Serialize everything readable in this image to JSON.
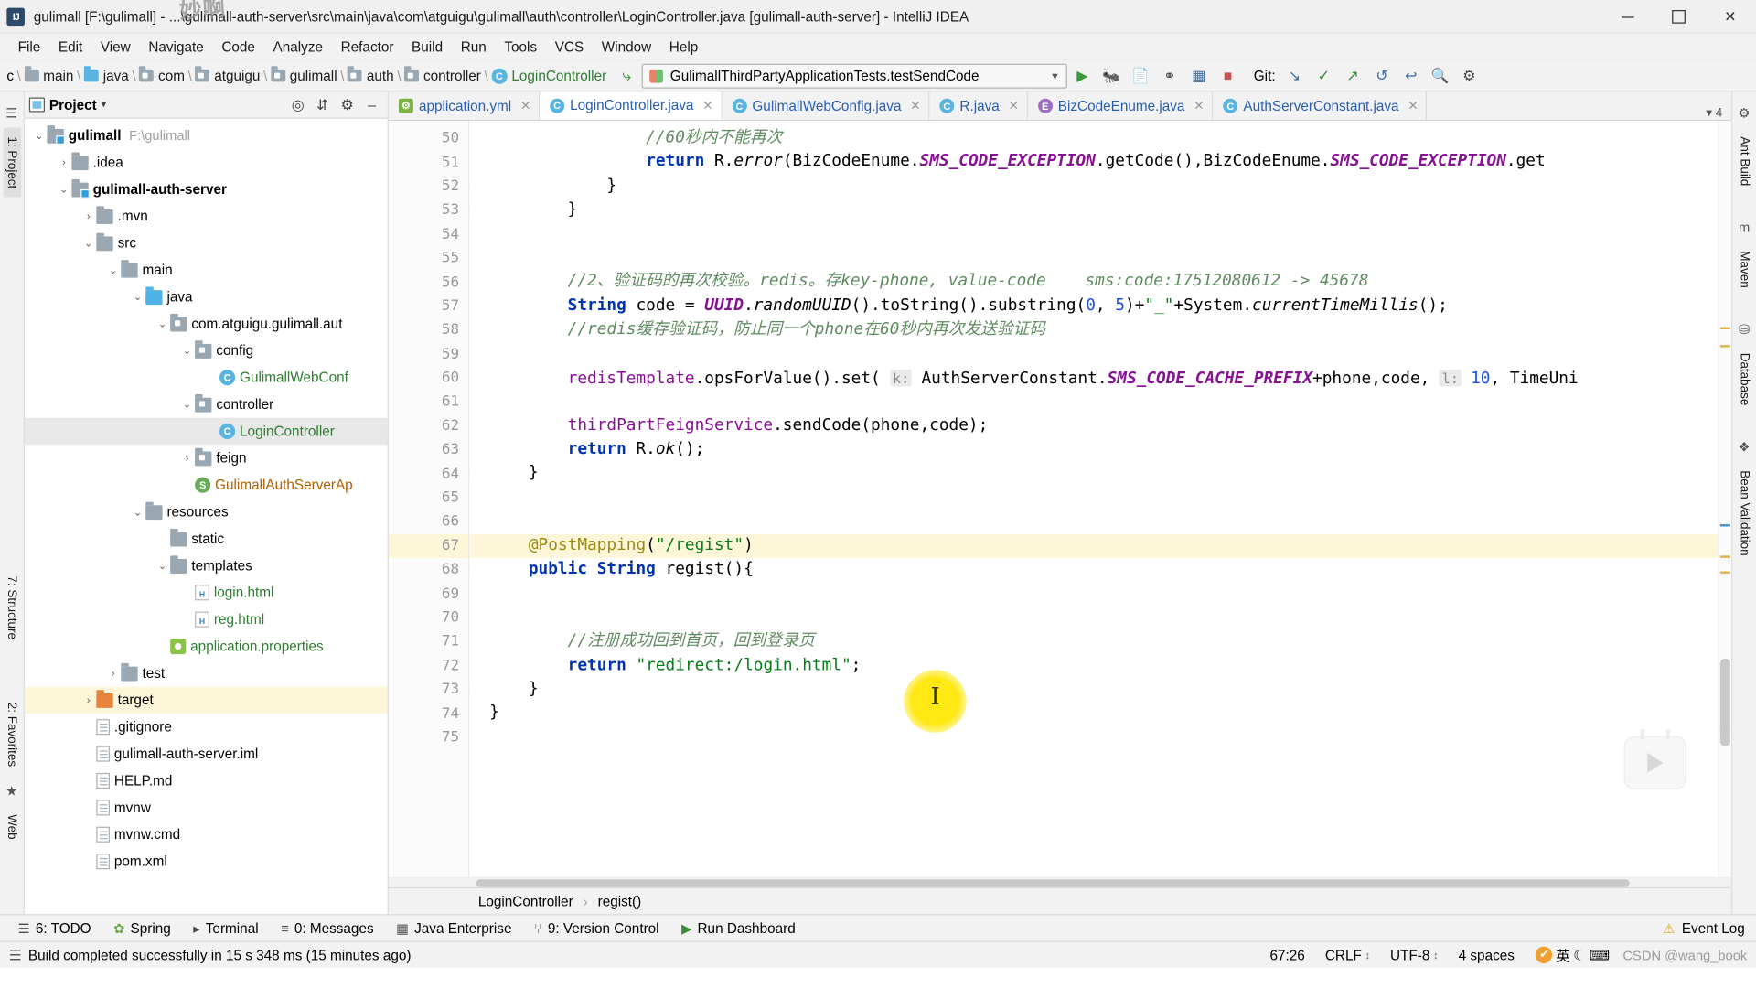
{
  "window": {
    "title": "gulimall [F:\\gulimall] - ...\\gulimall-auth-server\\src\\main\\java\\com\\atguigu\\gulimall\\auth\\controller\\LoginController.java [gulimall-auth-server] - IntelliJ IDEA",
    "app_icon": "IJ",
    "doodle": "妙啊",
    "minimize": "–",
    "maximize": "□",
    "close": "✕"
  },
  "menu": {
    "items": [
      "File",
      "Edit",
      "View",
      "Navigate",
      "Code",
      "Analyze",
      "Refactor",
      "Build",
      "Run",
      "Tools",
      "VCS",
      "Window",
      "Help"
    ]
  },
  "navbar": {
    "leading": "c",
    "crumbs": [
      {
        "label": "main",
        "icon": "folder-icon",
        "kind": "folder"
      },
      {
        "label": "java",
        "icon": "folder-icon-blue",
        "kind": "source-folder"
      },
      {
        "label": "com",
        "icon": "package-icon",
        "kind": "package"
      },
      {
        "label": "atguigu",
        "icon": "package-icon",
        "kind": "package"
      },
      {
        "label": "gulimall",
        "icon": "package-icon",
        "kind": "package"
      },
      {
        "label": "auth",
        "icon": "package-icon",
        "kind": "package"
      },
      {
        "label": "controller",
        "icon": "package-icon",
        "kind": "package"
      },
      {
        "label": "LoginController",
        "icon": "class-icon",
        "kind": "class"
      }
    ],
    "hammer_icon": "build-hammer-icon",
    "run_config": "GulimallThirdPartyApplicationTests.testSendCode",
    "actions": [
      "run-icon",
      "debug-icon",
      "run-with-coverage-icon",
      "profiler-icon",
      "build-project-icon",
      "stop-icon"
    ],
    "git_label": "Git:",
    "git_actions": [
      "update-project-icon",
      "commit-icon",
      "push-icon",
      "history-icon",
      "rollback-icon"
    ],
    "right_actions": [
      "search-everywhere-icon",
      "settings-icon"
    ]
  },
  "project": {
    "header": {
      "title": "Project",
      "caret": "▾",
      "actions": [
        "locate-icon",
        "collapse-all-icon",
        "settings-icon",
        "hide-icon"
      ]
    },
    "tree": [
      {
        "depth": 0,
        "arrow": "⌄",
        "icon": "module-icon",
        "label": "gulimall",
        "bold": true,
        "path": "F:\\gulimall"
      },
      {
        "depth": 1,
        "arrow": "›",
        "icon": "folder-icon",
        "label": ".idea"
      },
      {
        "depth": 1,
        "arrow": "⌄",
        "icon": "module-icon",
        "label": "gulimall-auth-server",
        "bold": true
      },
      {
        "depth": 2,
        "arrow": "›",
        "icon": "folder-icon",
        "label": ".mvn"
      },
      {
        "depth": 2,
        "arrow": "⌄",
        "icon": "folder-icon",
        "label": "src"
      },
      {
        "depth": 3,
        "arrow": "⌄",
        "icon": "folder-icon",
        "label": "main"
      },
      {
        "depth": 4,
        "arrow": "⌄",
        "icon": "source-folder-icon",
        "label": "java"
      },
      {
        "depth": 5,
        "arrow": "⌄",
        "icon": "package-icon",
        "label": "com.atguigu.gulimall.aut"
      },
      {
        "depth": 6,
        "arrow": "⌄",
        "icon": "package-icon",
        "label": "config"
      },
      {
        "depth": 7,
        "arrow": "",
        "icon": "class-icon",
        "label": "GulimallWebConf",
        "color": "green"
      },
      {
        "depth": 6,
        "arrow": "⌄",
        "icon": "package-icon",
        "label": "controller"
      },
      {
        "depth": 7,
        "arrow": "",
        "icon": "class-icon",
        "label": "LoginController",
        "color": "green",
        "selected": true
      },
      {
        "depth": 6,
        "arrow": "›",
        "icon": "package-icon",
        "label": "feign"
      },
      {
        "depth": 6,
        "arrow": "",
        "icon": "class-icon-green",
        "label": "GulimallAuthServerAp",
        "color": "orange"
      },
      {
        "depth": 4,
        "arrow": "⌄",
        "icon": "resource-folder-icon",
        "label": "resources"
      },
      {
        "depth": 5,
        "arrow": "",
        "icon": "folder-icon",
        "label": "static"
      },
      {
        "depth": 5,
        "arrow": "⌄",
        "icon": "folder-icon",
        "label": "templates"
      },
      {
        "depth": 6,
        "arrow": "",
        "icon": "html-file-icon",
        "label": "login.html",
        "color": "green"
      },
      {
        "depth": 6,
        "arrow": "",
        "icon": "html-file-icon",
        "label": "reg.html",
        "color": "green"
      },
      {
        "depth": 5,
        "arrow": "",
        "icon": "properties-file-icon",
        "label": "application.properties",
        "color": "green"
      },
      {
        "depth": 3,
        "arrow": "›",
        "icon": "folder-icon",
        "label": "test"
      },
      {
        "depth": 2,
        "arrow": "›",
        "icon": "folder-icon-orange",
        "label": "target",
        "highlight": true
      },
      {
        "depth": 2,
        "arrow": "",
        "icon": "file-icon",
        "label": ".gitignore"
      },
      {
        "depth": 2,
        "arrow": "",
        "icon": "file-icon",
        "label": "gulimall-auth-server.iml"
      },
      {
        "depth": 2,
        "arrow": "",
        "icon": "md-file-icon",
        "label": "HELP.md"
      },
      {
        "depth": 2,
        "arrow": "",
        "icon": "file-icon",
        "label": "mvnw"
      },
      {
        "depth": 2,
        "arrow": "",
        "icon": "file-icon",
        "label": "mvnw.cmd"
      },
      {
        "depth": 2,
        "arrow": "",
        "icon": "maven-file-icon",
        "label": "pom.xml",
        "color": "blue"
      }
    ]
  },
  "left_rail": {
    "items": [
      "1: Project",
      "7: Structure",
      "2: Favorites",
      "Web"
    ]
  },
  "right_rail": {
    "items": [
      "Ant Build",
      "Maven",
      "Database",
      "Bean Validation"
    ]
  },
  "editor": {
    "tabs": [
      {
        "label": "application.yml",
        "icon": "yml-file-icon",
        "active": false
      },
      {
        "label": "LoginController.java",
        "icon": "class-icon",
        "active": true
      },
      {
        "label": "GulimallWebConfig.java",
        "icon": "class-icon",
        "active": false
      },
      {
        "label": "R.java",
        "icon": "class-icon",
        "active": false
      },
      {
        "label": "BizCodeEnume.java",
        "icon": "enum-icon",
        "active": false
      },
      {
        "label": "AuthServerConstant.java",
        "icon": "class-icon",
        "active": false
      }
    ],
    "tabs_overflow": "▾ 4",
    "first_line": 50,
    "lines": [
      {
        "n": 50,
        "text": "                //60秒内不能再次"
      },
      {
        "n": 51,
        "text": "                return R.error(BizCodeEnume.SMS_CODE_EXCEPTION.getCode(),BizCodeEnume.SMS_CODE_EXCEPTION.get"
      },
      {
        "n": 52,
        "text": "            }",
        "fold": true
      },
      {
        "n": 53,
        "text": "        }",
        "fold": true
      },
      {
        "n": 54,
        "text": ""
      },
      {
        "n": 55,
        "text": ""
      },
      {
        "n": 56,
        "text": "        //2、验证码的再次校验。redis。存key-phone, value-code    sms:code:17512080612 -> 45678"
      },
      {
        "n": 57,
        "text": "        String code = UUID.randomUUID().toString().substring(0, 5)+\"_\"+System.currentTimeMillis();"
      },
      {
        "n": 58,
        "text": "        //redis缓存验证码，防止同一个phone在60秒内再次发送验证码"
      },
      {
        "n": 59,
        "text": ""
      },
      {
        "n": 60,
        "text": "        redisTemplate.opsForValue().set( k: AuthServerConstant.SMS_CODE_CACHE_PREFIX+phone,code, l: 10, TimeUni"
      },
      {
        "n": 61,
        "text": ""
      },
      {
        "n": 62,
        "text": "        thirdPartFeignService.sendCode(phone,code);"
      },
      {
        "n": 63,
        "text": "        return R.ok();"
      },
      {
        "n": 64,
        "text": "    }",
        "fold": true
      },
      {
        "n": 65,
        "text": ""
      },
      {
        "n": 66,
        "text": ""
      },
      {
        "n": 67,
        "text": "    @PostMapping(\"/regist\")",
        "bulb": true,
        "highlight": true
      },
      {
        "n": 68,
        "text": "    public String regist(){",
        "fold": true
      },
      {
        "n": 69,
        "text": ""
      },
      {
        "n": 70,
        "text": ""
      },
      {
        "n": 71,
        "text": "        //注册成功回到首页，回到登录页"
      },
      {
        "n": 72,
        "text": "        return \"redirect:/login.html\";"
      },
      {
        "n": 73,
        "text": "    }",
        "fold": true
      },
      {
        "n": 74,
        "text": "}"
      },
      {
        "n": 75,
        "text": ""
      }
    ],
    "breadcrumb": [
      "LoginController",
      "regist()"
    ],
    "breadcrumb_sep": "›"
  },
  "bottom_tools": [
    {
      "label": "6: TODO",
      "icon": "todo-icon"
    },
    {
      "label": "Spring",
      "icon": "spring-icon"
    },
    {
      "label": "Terminal",
      "icon": "terminal-icon"
    },
    {
      "label": "0: Messages",
      "icon": "messages-icon"
    },
    {
      "label": "Java Enterprise",
      "icon": "java-enterprise-icon"
    },
    {
      "label": "9: Version Control",
      "icon": "version-control-icon"
    },
    {
      "label": "Run Dashboard",
      "icon": "run-dashboard-icon"
    }
  ],
  "event_log": {
    "label": "Event Log",
    "icon": "event-log-icon"
  },
  "statusbar": {
    "message": "Build completed successfully in 15 s 348 ms (15 minutes ago)",
    "caret_position": "67:26",
    "line_separator": "CRLF",
    "encoding": "UTF-8",
    "indent": "4 spaces",
    "ime": "英",
    "credit": "CSDN @wang_book"
  },
  "colors": {
    "accent_blue": "#2a5db0",
    "keyword": "#0033b3",
    "string": "#067d17",
    "comment": "#8c8c8c",
    "static_field": "#871094",
    "annotation": "#9e880d",
    "highlight_row": "#fdf6d8",
    "cursor_blob": "#ffe814"
  }
}
